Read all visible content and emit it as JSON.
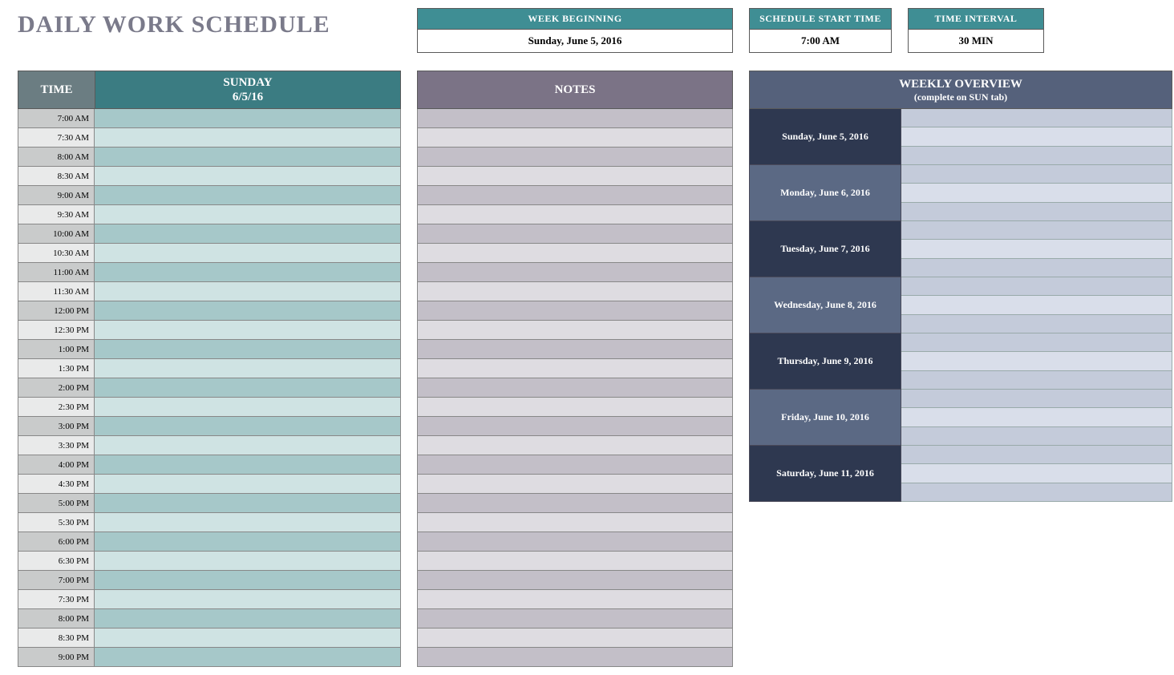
{
  "title": "DAILY WORK SCHEDULE",
  "info": {
    "week_label": "WEEK BEGINNING",
    "week_value": "Sunday, June 5, 2016",
    "start_label": "SCHEDULE START TIME",
    "start_value": "7:00 AM",
    "interval_label": "TIME INTERVAL",
    "interval_value": "30 MIN"
  },
  "schedule": {
    "time_header": "TIME",
    "day_header_line1": "SUNDAY",
    "day_header_line2": "6/5/16",
    "times": [
      "7:00 AM",
      "7:30 AM",
      "8:00 AM",
      "8:30 AM",
      "9:00 AM",
      "9:30 AM",
      "10:00 AM",
      "10:30 AM",
      "11:00 AM",
      "11:30 AM",
      "12:00 PM",
      "12:30 PM",
      "1:00 PM",
      "1:30 PM",
      "2:00 PM",
      "2:30 PM",
      "3:00 PM",
      "3:30 PM",
      "4:00 PM",
      "4:30 PM",
      "5:00 PM",
      "5:30 PM",
      "6:00 PM",
      "6:30 PM",
      "7:00 PM",
      "7:30 PM",
      "8:00 PM",
      "8:30 PM",
      "9:00 PM"
    ],
    "slots": [
      "",
      "",
      "",
      "",
      "",
      "",
      "",
      "",
      "",
      "",
      "",
      "",
      "",
      "",
      "",
      "",
      "",
      "",
      "",
      "",
      "",
      "",
      "",
      "",
      "",
      "",
      "",
      "",
      ""
    ]
  },
  "notes": {
    "header": "NOTES",
    "rows": [
      "",
      "",
      "",
      "",
      "",
      "",
      "",
      "",
      "",
      "",
      "",
      "",
      "",
      "",
      "",
      "",
      "",
      "",
      "",
      "",
      "",
      "",
      "",
      "",
      "",
      "",
      "",
      "",
      ""
    ]
  },
  "overview": {
    "header": "WEEKLY OVERVIEW",
    "subheader": "(complete on SUN tab)",
    "days": [
      "Sunday, June 5, 2016",
      "Monday, June 6, 2016",
      "Tuesday, June 7, 2016",
      "Wednesday, June 8, 2016",
      "Thursday, June 9, 2016",
      "Friday, June 10, 2016",
      "Saturday, June 11, 2016"
    ]
  }
}
